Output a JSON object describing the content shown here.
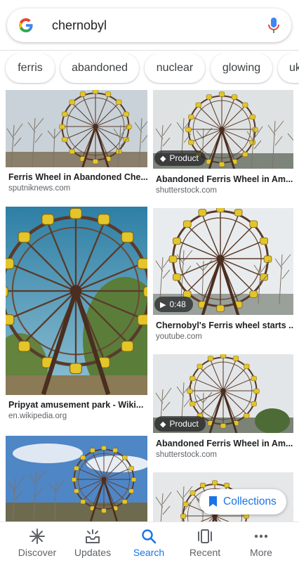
{
  "search": {
    "query": "chernobyl"
  },
  "chips": [
    "ferris",
    "abandoned",
    "nuclear",
    "glowing",
    "uk"
  ],
  "results": [
    {
      "caption": "Ferris Wheel in Abandoned Che...",
      "source": "sputniknews.com"
    },
    {
      "caption": "Abandoned Ferris Wheel in Am...",
      "source": "shutterstock.com",
      "badge": "Product"
    },
    {
      "caption": "Pripyat amusement park - Wiki...",
      "source": "en.wikipedia.org"
    },
    {
      "caption": "Chernobyl's Ferris wheel starts ...",
      "source": "youtube.com",
      "badge": "0:48"
    },
    {
      "caption": "Abandoned Ferris Wheel in Am...",
      "source": "shutterstock.com",
      "badge": "Product"
    }
  ],
  "collections_label": "Collections",
  "nav": [
    {
      "label": "Discover",
      "icon": "asterisk-icon"
    },
    {
      "label": "Updates",
      "icon": "updates-icon"
    },
    {
      "label": "Search",
      "icon": "search-icon",
      "active": true
    },
    {
      "label": "Recent",
      "icon": "recent-tabs-icon"
    },
    {
      "label": "More",
      "icon": "more-dots-icon"
    }
  ],
  "colors": {
    "accent": "#1a73e8",
    "google_blue": "#4285F4",
    "google_red": "#EA4335",
    "google_yellow": "#FBBC05",
    "google_green": "#34A853"
  }
}
